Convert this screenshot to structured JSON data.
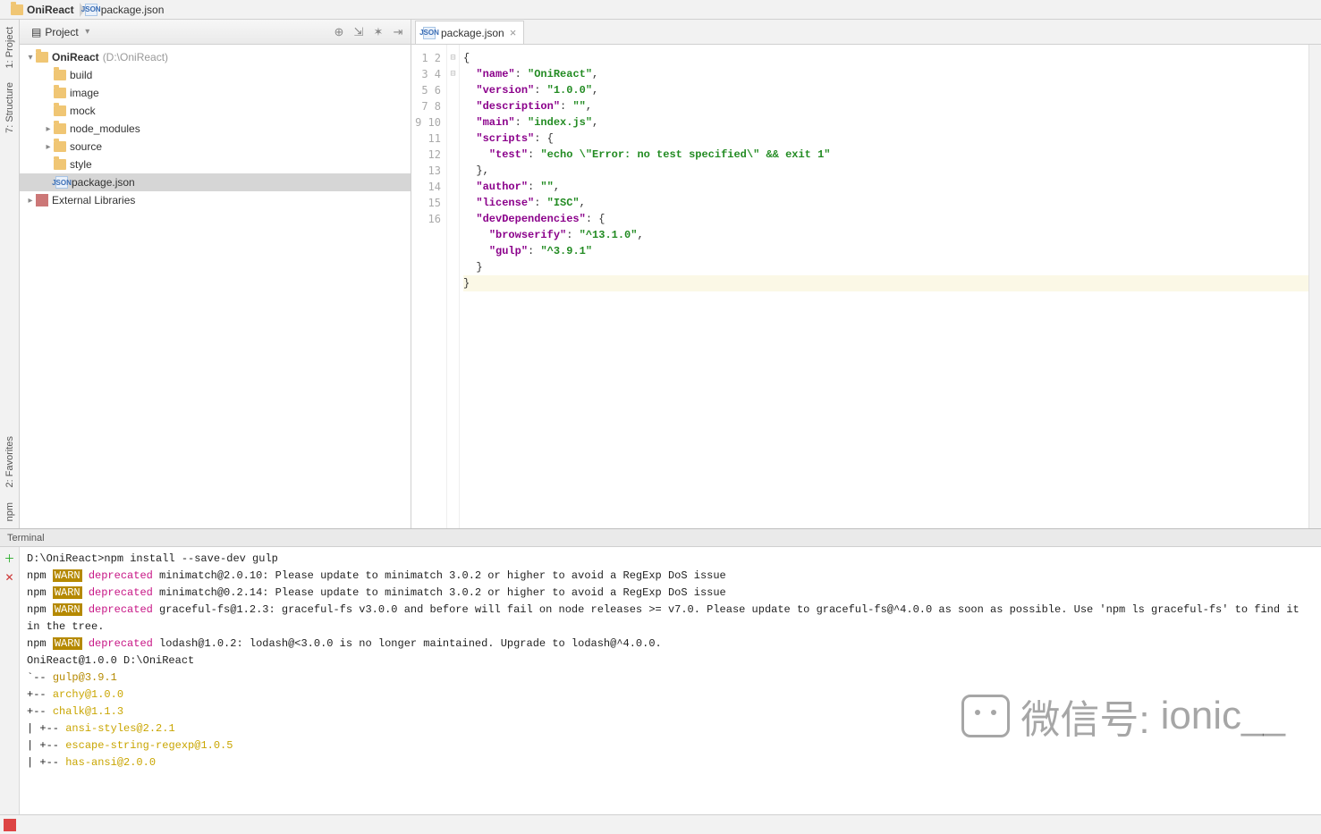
{
  "breadcrumb": {
    "root": "OniReact",
    "file": "package.json"
  },
  "projectPanel": {
    "selectorLabel": "Project",
    "root": {
      "name": "OniReact",
      "hint": "(D:\\OniReact)"
    },
    "folders": [
      "build",
      "image",
      "mock",
      "node_modules",
      "source",
      "style"
    ],
    "file": "package.json",
    "external": "External Libraries"
  },
  "sideTabs": {
    "project": "1: Project",
    "structure": "7: Structure",
    "favorites": "2: Favorites",
    "npm": "npm"
  },
  "tab": {
    "name": "package.json"
  },
  "editor": {
    "lines": 16,
    "json": {
      "name": "OniReact",
      "version": "1.0.0",
      "description": "",
      "main": "index.js",
      "scripts_test": "echo \\\"Error: no test specified\\\" && exit 1",
      "author": "",
      "license": "ISC",
      "dev_browserify": "^13.1.0",
      "dev_gulp": "^3.9.1"
    }
  },
  "terminal": {
    "title": "Terminal",
    "prompt": "D:\\OniReact>",
    "cmd": "npm install --save-dev gulp",
    "warn": [
      "minimatch@2.0.10: Please update to minimatch 3.0.2 or higher to avoid a RegExp DoS issue",
      "minimatch@0.2.14: Please update to minimatch 3.0.2 or higher to avoid a RegExp DoS issue",
      "graceful-fs@1.2.3: graceful-fs v3.0.0 and before will fail on node releases >= v7.0. Please update to graceful-fs@^4.0.0 as soon as possible. Use 'npm ls graceful-fs' to find it in the tree.",
      "lodash@1.0.2: lodash@<3.0.0 is no longer maintained. Upgrade to lodash@^4.0.0."
    ],
    "after": "OniReact@1.0.0 D:\\OniReact",
    "tree": [
      {
        "t": "`-- ",
        "p": "gulp@3.9.1",
        "c": "ylw"
      },
      {
        "t": "  +-- ",
        "p": "archy@1.0.0",
        "c": "yl2"
      },
      {
        "t": "  +-- ",
        "p": "chalk@1.1.3",
        "c": "yl2"
      },
      {
        "t": "  | +-- ",
        "p": "ansi-styles@2.2.1",
        "c": "yl2"
      },
      {
        "t": "  | +-- ",
        "p": "escape-string-regexp@1.0.5",
        "c": "yl2"
      },
      {
        "t": "  | +-- ",
        "p": "has-ansi@2.0.0",
        "c": "yl2"
      }
    ]
  },
  "watermark": {
    "label": "微信号:",
    "handle": "ionic__"
  }
}
